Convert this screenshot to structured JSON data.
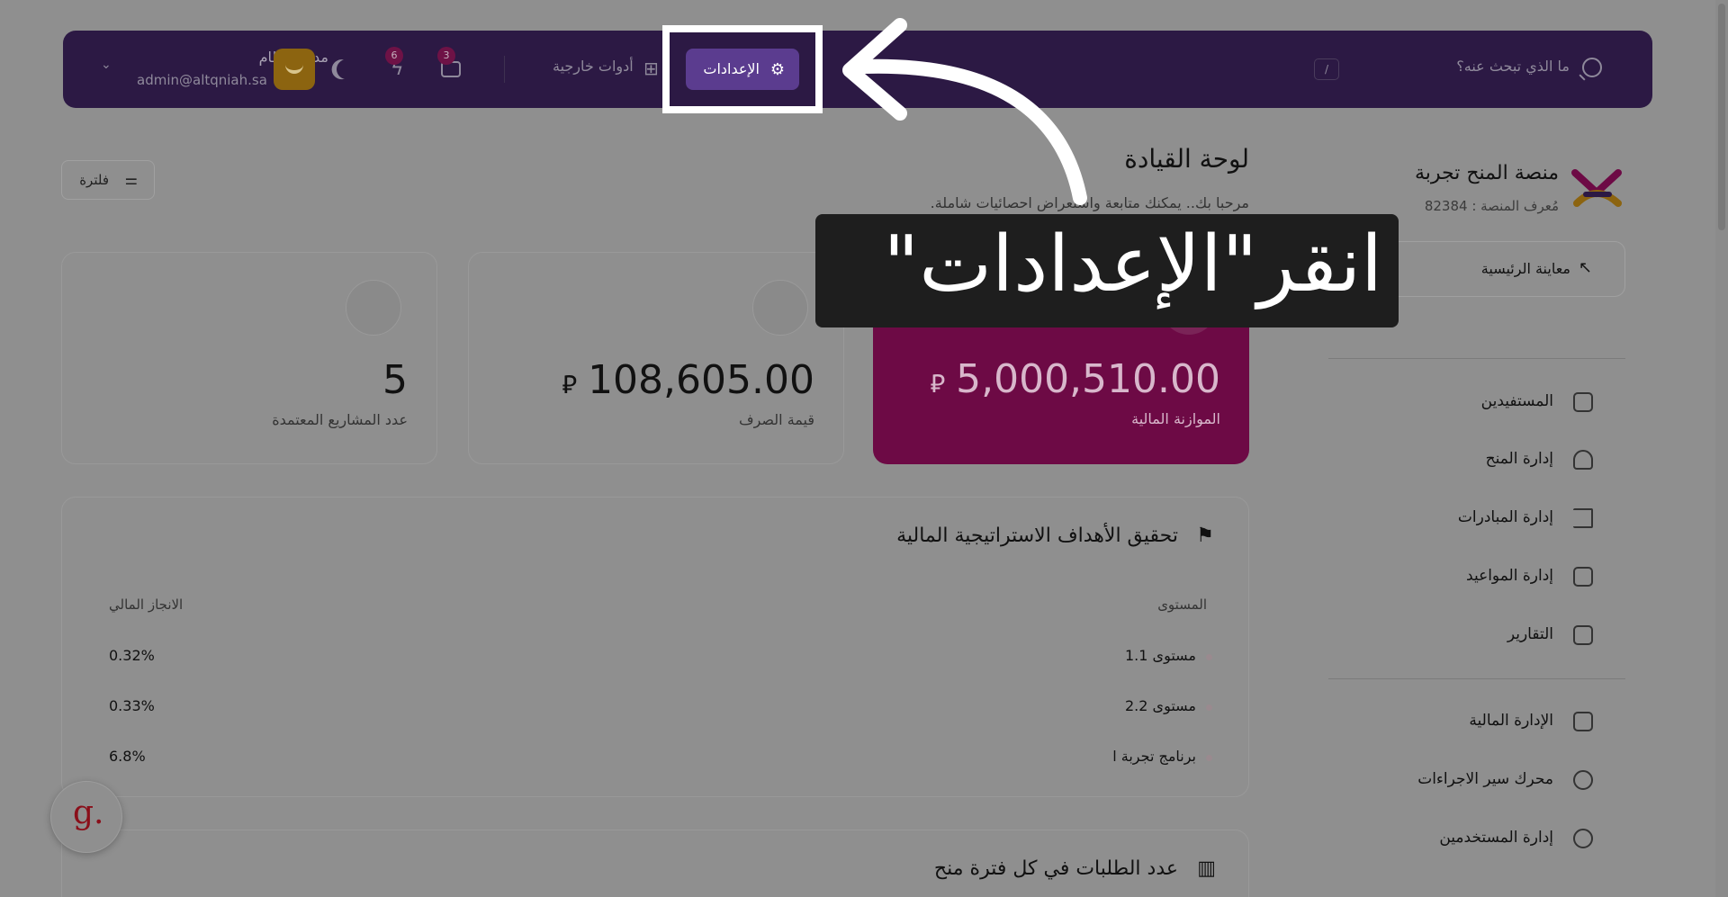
{
  "topbar": {
    "search_placeholder": "ما الذي تبحث عنه؟",
    "shortcut_key": "/",
    "settings_label": "الإعدادات",
    "tools_label": "أدوات خارجية",
    "notifications_count": "6",
    "messages_count": "3",
    "user_name": "مدير النظام",
    "user_email": "admin@altqniah.sa"
  },
  "sidebar": {
    "brand_title": "منصة المنح تجربة",
    "platform_id": "مُعرف المنصة : 82384",
    "preview_label": "معاينة الرئيسية",
    "items": [
      {
        "label": "المستفيدين",
        "icon": "user-square-icon"
      },
      {
        "label": "إدارة المنح",
        "icon": "hand-heart-icon"
      },
      {
        "label": "إدارة المبادرات",
        "icon": "flag-icon"
      },
      {
        "label": "إدارة المواعيد",
        "icon": "calendar-icon"
      },
      {
        "label": "التقارير",
        "icon": "report-icon"
      },
      {
        "label": "الإدارة المالية",
        "icon": "ledger-icon"
      },
      {
        "label": "محرك سير الاجراءات",
        "icon": "workflow-icon"
      },
      {
        "label": "إدارة المستخدمين",
        "icon": "users-icon"
      }
    ]
  },
  "main": {
    "title": "لوحة القيادة",
    "subtitle": "مرحبا بك.. يمكنك متابعة واستعراض احصائيات شاملة.",
    "filter_label": "فلترة",
    "kpis": [
      {
        "value": "5,000,510.00",
        "label": "الموازنة المالية",
        "currency": "⃁"
      },
      {
        "value": "108,605.00",
        "label": "قيمة الصرف",
        "currency": "⃁"
      },
      {
        "value": "5",
        "label": "عدد المشاريع المعتمدة"
      }
    ],
    "goals_panel": {
      "title": "تحقيق الأهداف الاستراتيجية المالية",
      "col_level": "المستوى",
      "col_achievement": "الانجاز المالي",
      "rows": [
        {
          "level": "مستوى 1.1",
          "pct": "0.32%"
        },
        {
          "level": "مستوى 2.2",
          "pct": "0.33%"
        },
        {
          "level": "برنامج تجربة ا",
          "pct": "6.8%"
        }
      ]
    },
    "requests_panel": {
      "title": "عدد الطلبات في كل فترة منح"
    }
  },
  "hint": {
    "text": "انقر\"الإعدادات\""
  },
  "colors": {
    "topbar": "#2c1944",
    "budget_card": "#6d0a45",
    "settings_button": "#5b3c8f"
  }
}
